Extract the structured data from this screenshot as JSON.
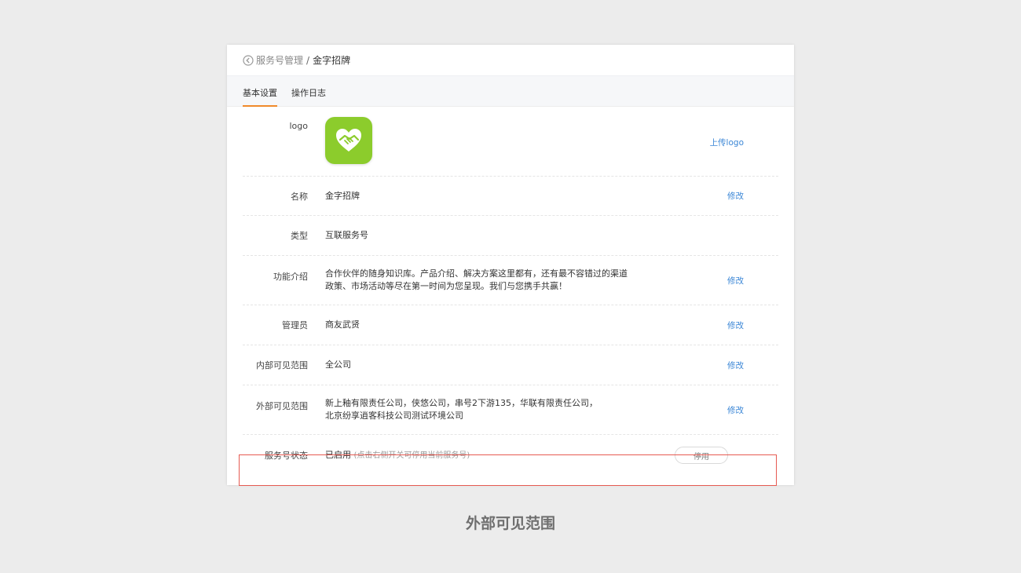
{
  "breadcrumb": {
    "parent": "服务号管理",
    "separator": "/",
    "current": "金字招牌"
  },
  "tabs": [
    {
      "label": "基本设置",
      "active": true
    },
    {
      "label": "操作日志",
      "active": false
    }
  ],
  "rows": {
    "logo": {
      "label": "logo",
      "action": "上传logo"
    },
    "name": {
      "label": "名称",
      "value": "金字招牌",
      "action": "修改"
    },
    "type": {
      "label": "类型",
      "value": "互联服务号"
    },
    "intro": {
      "label": "功能介绍",
      "line1": "合作伙伴的随身知识库。产品介绍、解决方案这里都有，还有最不容错过的渠道",
      "line2": "政策、市场活动等尽在第一时间为您呈现。我们与您携手共赢！",
      "action": "修改"
    },
    "admin": {
      "label": "管理员",
      "value": "商友武贤",
      "action": "修改"
    },
    "internal": {
      "label": "内部可见范围",
      "value": "全公司",
      "action": "修改"
    },
    "external": {
      "label": "外部可见范围",
      "line1": "新上釉有限责任公司，侠悠公司，串号2下游135，华联有限责任公司，",
      "line2": "北京纷享逍客科技公司测试环境公司",
      "action": "修改"
    },
    "status": {
      "label": "服务号状态",
      "value": "已启用",
      "hint": "(点击右侧开关可停用当前服务号)",
      "button": "停用"
    }
  },
  "caption": "外部可见范围",
  "colors": {
    "accent": "#f08a2a",
    "link": "#3a86d6",
    "logo_bg": "#8ccc2c",
    "highlight": "#e65a52"
  },
  "icons": {
    "back": "chevron-left-circle-icon",
    "logo": "handshake-heart-icon"
  }
}
